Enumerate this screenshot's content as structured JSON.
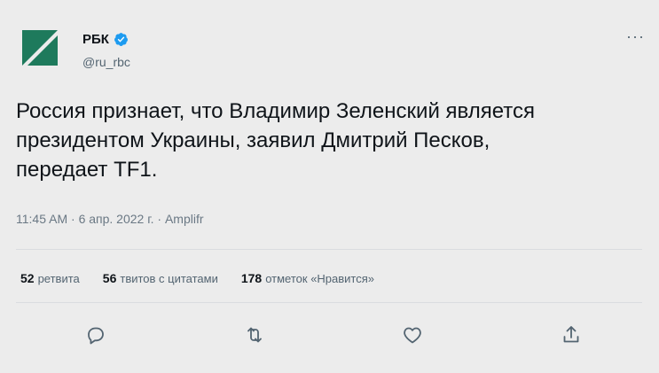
{
  "account": {
    "display_name": "РБК",
    "handle": "@ru_rbc",
    "verified": true,
    "avatar_colors": [
      "#1e7a5c",
      "#ffffff"
    ]
  },
  "menu": {
    "more_label": "···"
  },
  "tweet": {
    "text": "Россия признает, что Владимир Зеленский является\nпрезидентом Украины, заявил Дмитрий Песков,\nпередает TF1.",
    "time": "11:45 AM",
    "date": "6 апр. 2022 г.",
    "source": "Amplifr",
    "separator": " · "
  },
  "stats": {
    "retweets_count": "52",
    "retweets_label": "ретвита",
    "quotes_count": "56",
    "quotes_label": "твитов с цитатами",
    "likes_count": "178",
    "likes_label": "отметок «Нравится»"
  },
  "actions": [
    {
      "icon": "reply-icon"
    },
    {
      "icon": "retweet-icon"
    },
    {
      "icon": "like-icon"
    },
    {
      "icon": "share-icon"
    }
  ],
  "colors": {
    "background": "#ececec",
    "verified_badge": "#1d9bf0",
    "secondary_text": "#536471",
    "primary_text": "#0f1419"
  }
}
